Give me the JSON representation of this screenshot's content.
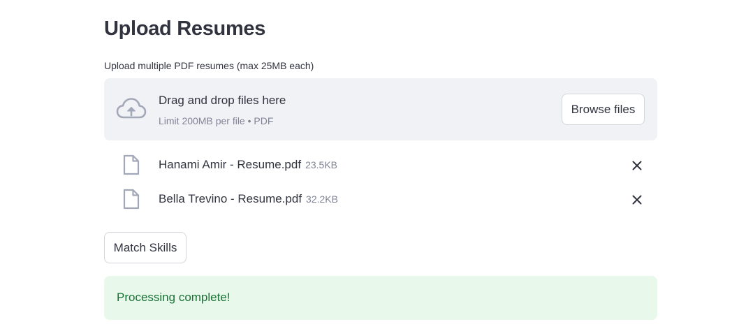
{
  "page": {
    "title": "Upload Resumes"
  },
  "uploader": {
    "label": "Upload multiple PDF resumes (max 25MB each)",
    "dropzone_title": "Drag and drop files here",
    "dropzone_subtitle": "Limit 200MB per file • PDF",
    "browse_label": "Browse files",
    "icon": "cloud-upload-icon"
  },
  "files": [
    {
      "name": "Hanami Amir - Resume.pdf",
      "size": "23.5KB",
      "icon": "file-icon"
    },
    {
      "name": "Bella Trevino - Resume.pdf",
      "size": "32.2KB",
      "icon": "file-icon"
    }
  ],
  "actions": {
    "match_label": "Match Skills"
  },
  "status": {
    "message": "Processing complete!"
  },
  "colors": {
    "text": "#31333f",
    "muted": "#808495",
    "dropzone_bg": "#f0f2f6",
    "icon": "#a3a8b8",
    "success_bg": "#e8f9ec",
    "success_text": "#177233"
  }
}
